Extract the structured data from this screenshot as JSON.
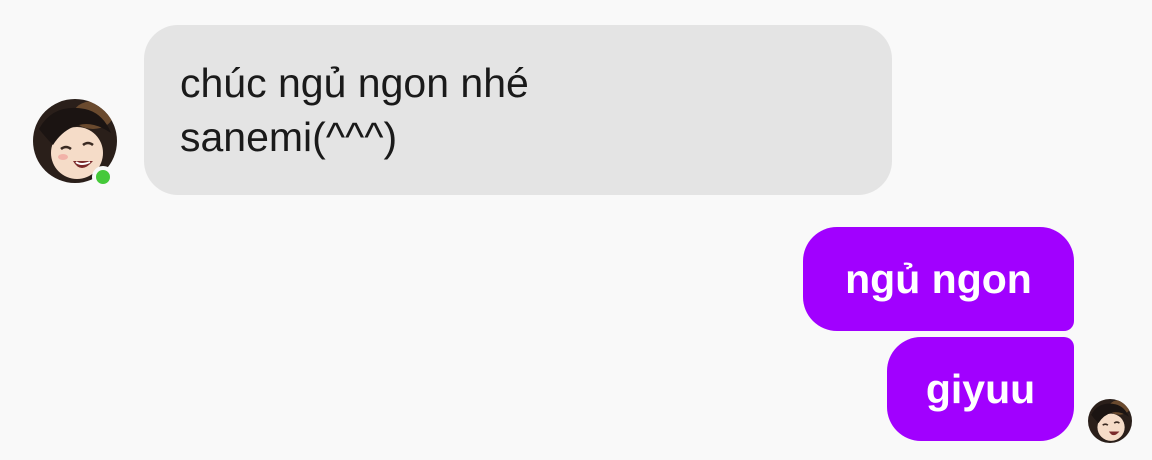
{
  "conversation": {
    "received": {
      "lines": [
        "chúc ngủ ngon nhé",
        "sanemi(^^^)"
      ],
      "sender_online": true,
      "online_color": "#45c93a",
      "bubble_color": "#e4e4e4"
    },
    "sent": [
      {
        "text": "ngủ ngon"
      },
      {
        "text": "giyuu"
      }
    ],
    "sent_bubble_color": "#a100ff",
    "read_receipt": true
  },
  "icons": {
    "sender_avatar": "anime-avatar-icon",
    "online_indicator": "online-status-dot",
    "read_receipt_avatar": "seen-avatar-icon"
  }
}
